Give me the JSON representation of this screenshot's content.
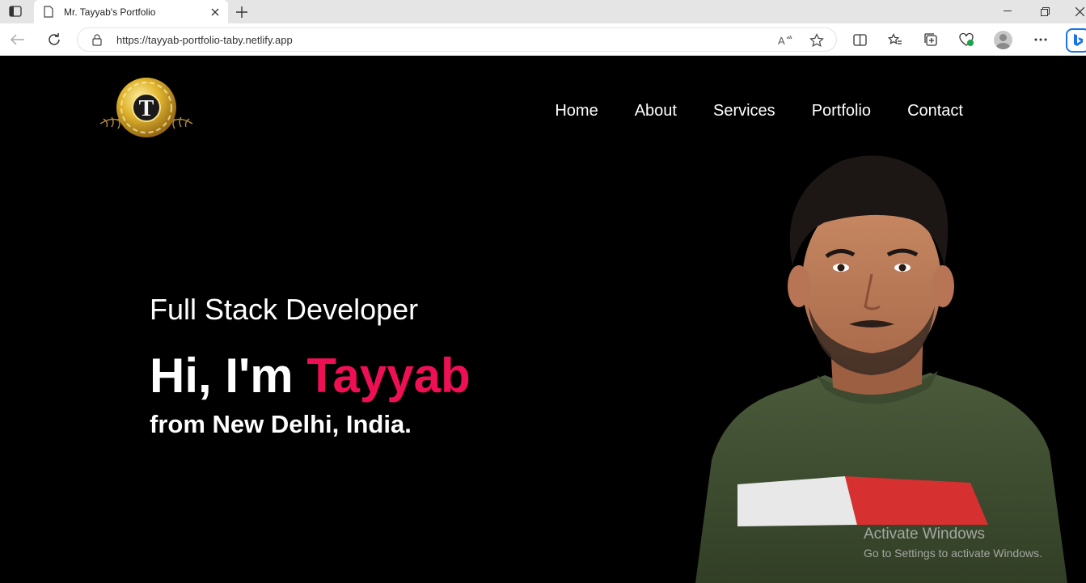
{
  "browser": {
    "tab_title": "Mr. Tayyab's Portfolio",
    "url": "https://tayyab-portfolio-taby.netlify.app"
  },
  "nav": {
    "items": [
      {
        "label": "Home"
      },
      {
        "label": "About"
      },
      {
        "label": "Services"
      },
      {
        "label": "Portfolio"
      },
      {
        "label": "Contact"
      }
    ]
  },
  "hero": {
    "subtitle": "Full Stack Developer",
    "greeting": "Hi, I'm",
    "name": "Tayyab",
    "location": "from New Delhi, India.",
    "accent_color": "#ee0f55"
  },
  "logo": {
    "letter": "T"
  },
  "watermark": {
    "line1": "Activate Windows",
    "line2": "Go to Settings to activate Windows."
  }
}
